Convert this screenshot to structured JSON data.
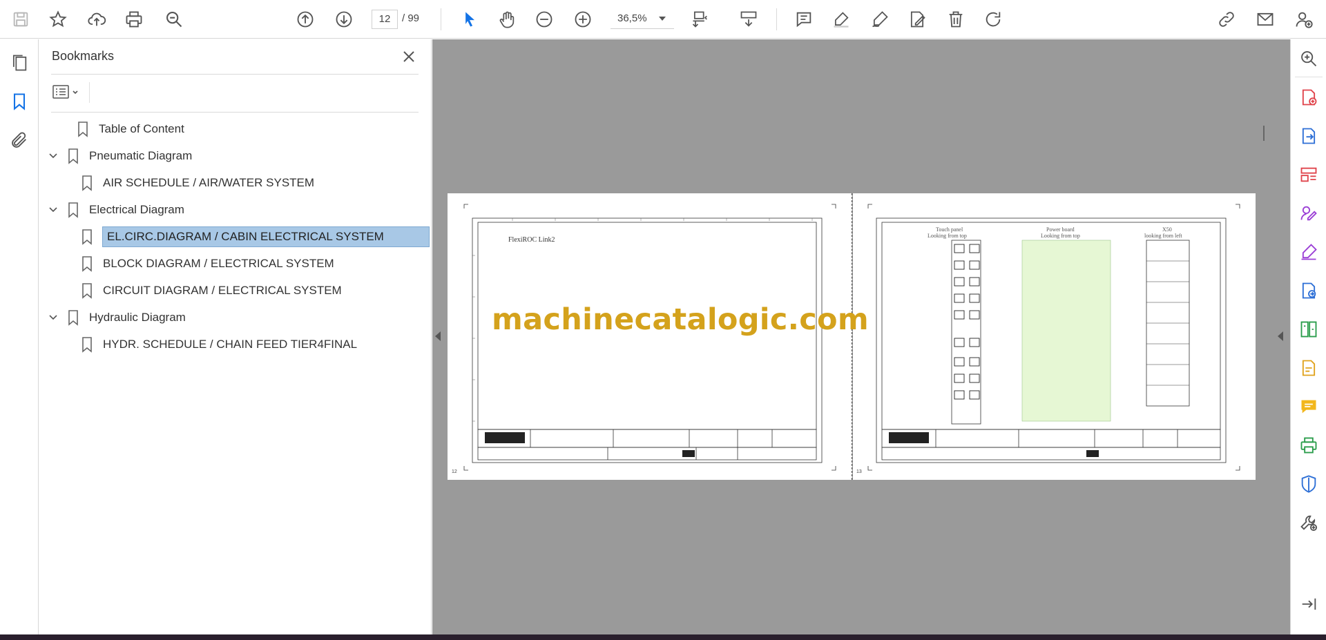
{
  "toolbar": {
    "page_current": "12",
    "page_total": "/ 99",
    "zoom": "36,5%"
  },
  "panel": {
    "title": "Bookmarks"
  },
  "bookmarks": [
    {
      "label": "Table of Content"
    },
    {
      "label": "Pneumatic Diagram"
    },
    {
      "label": "AIR SCHEDULE / AIR/WATER SYSTEM"
    },
    {
      "label": "Electrical Diagram"
    },
    {
      "label": "EL.CIRC.DIAGRAM / CABIN ELECTRICAL SYSTEM"
    },
    {
      "label": "BLOCK DIAGRAM / ELECTRICAL SYSTEM"
    },
    {
      "label": "CIRCUIT DIAGRAM / ELECTRICAL SYSTEM"
    },
    {
      "label": "Hydraulic Diagram"
    },
    {
      "label": "HYDR. SCHEDULE / CHAIN FEED TIER4FINAL"
    }
  ],
  "document": {
    "watermark": "machinecatalogic.com",
    "page1": {
      "number": "12",
      "title": "FlexiROC Link2"
    },
    "page2": {
      "number": "13",
      "headers": [
        "Touch panel",
        "Looking from top",
        "Power board",
        "Looking from top",
        "X50",
        "looking from left"
      ]
    }
  },
  "colors": {
    "accent": "#1473e6",
    "selection": "#a8c8e6",
    "watermark": "#d4a21c",
    "doc_background": "#9a9a9a"
  },
  "icons": {
    "toolbar": [
      "save-icon",
      "star-icon",
      "upload-icon",
      "print-icon",
      "zoom-search-icon",
      "prev-page-icon",
      "next-page-icon",
      "select-cursor-icon",
      "hand-icon",
      "zoom-out-icon",
      "zoom-in-icon",
      "page-fit-icon",
      "scroll-mode-icon",
      "comment-icon",
      "highlight-icon",
      "draw-icon",
      "edit-icon",
      "delete-icon",
      "rotate-icon",
      "link-icon",
      "mail-icon",
      "account-icon"
    ],
    "right_rail": [
      "zoom-icon",
      "create-pdf-icon",
      "export-pdf-icon",
      "organize-pages-icon",
      "request-signature-icon",
      "fill-sign-icon",
      "convert-icon",
      "compare-icon",
      "edit-pdf-icon",
      "comment-tool-icon",
      "print-production-icon",
      "protect-icon",
      "more-tools-icon",
      "expand-icon"
    ]
  }
}
